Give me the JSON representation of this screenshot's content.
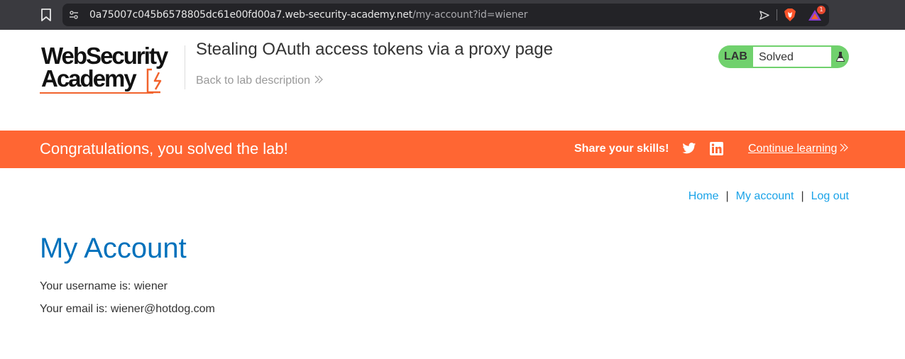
{
  "browser": {
    "url_host": "0a75007c045b6578805dc61e00fd00a7.web-security-academy.net",
    "url_path": "/my-account?id=wiener",
    "rewards_badge": "1"
  },
  "header": {
    "logo_line1": "WebSecurity",
    "logo_line2": "Academy",
    "lab_title": "Stealing OAuth access tokens via a proxy page",
    "back_link": "Back to lab description",
    "lab_tag": "LAB",
    "lab_status": "Solved"
  },
  "banner": {
    "message": "Congratulations, you solved the lab!",
    "share_label": "Share your skills!",
    "continue_label": "Continue learning",
    "color": "#ff6633"
  },
  "nav": {
    "home": "Home",
    "separator": "|",
    "my_account": "My account",
    "log_out": "Log out"
  },
  "main": {
    "heading": "My Account",
    "username_line": "Your username is: wiener",
    "email_line": "Your email is: wiener@hotdog.com"
  },
  "icons": {
    "bookmark": "bookmark-icon",
    "site_settings": "site-settings-icon",
    "share": "send-icon",
    "brave": "brave-shield-icon",
    "rewards": "brave-rewards-icon",
    "flask": "flask-icon",
    "twitter": "twitter-icon",
    "linkedin": "linkedin-icon"
  },
  "colors": {
    "accent_orange": "#ff6633",
    "heading_blue": "#0071bc",
    "link_blue": "#1aa3e8",
    "solved_green": "#70d16d"
  }
}
